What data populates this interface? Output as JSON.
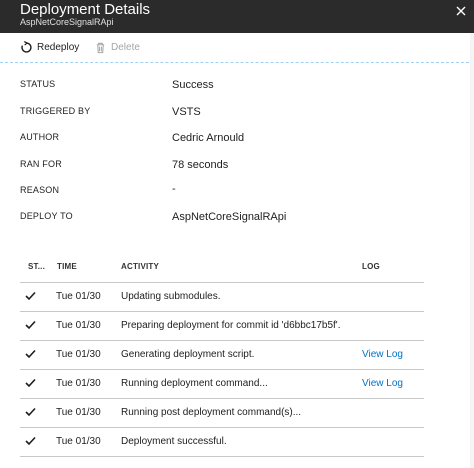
{
  "header": {
    "title": "Deployment Details",
    "subtitle": "AspNetCoreSignalRApi"
  },
  "toolbar": {
    "redeploy_label": "Redeploy",
    "delete_label": "Delete"
  },
  "details": [
    {
      "label": "STATUS",
      "value": "Success"
    },
    {
      "label": "TRIGGERED BY",
      "value": "VSTS"
    },
    {
      "label": "AUTHOR",
      "value": "Cedric Arnould"
    },
    {
      "label": "RAN FOR",
      "value": "78 seconds"
    },
    {
      "label": "REASON",
      "value": "-"
    },
    {
      "label": "DEPLOY TO",
      "value": "AspNetCoreSignalRApi"
    }
  ],
  "table": {
    "columns": [
      "ST...",
      "TIME",
      "ACTIVITY",
      "LOG"
    ],
    "rows": [
      {
        "status_icon": "checkmark-icon",
        "time": "Tue 01/30",
        "activity": "Updating submodules.",
        "log": ""
      },
      {
        "status_icon": "checkmark-icon",
        "time": "Tue 01/30",
        "activity": "Preparing deployment for commit id 'd6bbc17b5f'.",
        "log": ""
      },
      {
        "status_icon": "checkmark-icon",
        "time": "Tue 01/30",
        "activity": "Generating deployment script.",
        "log": "View Log"
      },
      {
        "status_icon": "checkmark-icon",
        "time": "Tue 01/30",
        "activity": "Running deployment command...",
        "log": "View Log"
      },
      {
        "status_icon": "checkmark-icon",
        "time": "Tue 01/30",
        "activity": "Running post deployment command(s)...",
        "log": ""
      },
      {
        "status_icon": "checkmark-icon",
        "time": "Tue 01/30",
        "activity": "Deployment successful.",
        "log": ""
      }
    ]
  },
  "colors": {
    "header_bg": "#2b2b2b",
    "link": "#0072c6",
    "disabled": "#a6a6a6"
  }
}
